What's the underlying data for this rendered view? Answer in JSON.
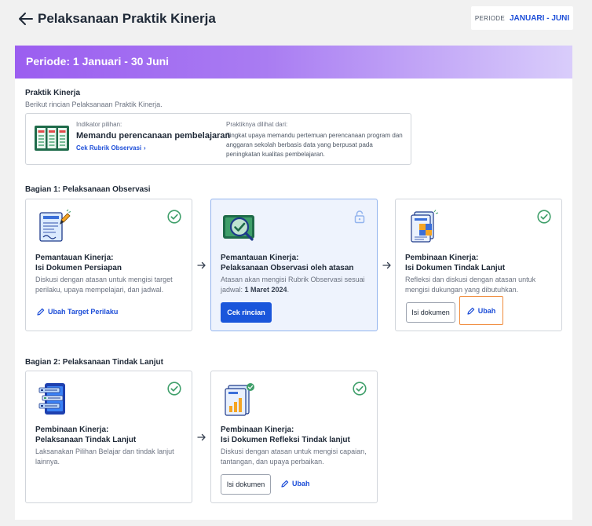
{
  "header": {
    "title": "Pelaksanaan Praktik Kinerja",
    "periode_label": "PERIODE",
    "periode_value": "JANUARI - JUNI"
  },
  "banner": {
    "text": "Periode: 1 Januari - 30 Juni"
  },
  "praktik": {
    "title": "Praktik Kinerja",
    "subtitle": "Berikut rincian Pelaksanaan Praktik Kinerja.",
    "indikator_label": "Indikator pilihan:",
    "indikator_value": "Memandu perencanaan pembelajaran",
    "rubrik_link": "Cek Rubrik Observasi",
    "rubrik_chevron": "›",
    "praktik_label": "Praktiknya dilihat dari:",
    "praktik_value": "Tingkat upaya memandu pertemuan perencanaan program dan anggaran sekolah berbasis data yang berpusat pada peningkatan kualitas pembelajaran."
  },
  "bagian1": {
    "title": "Bagian 1: Pelaksanaan Observasi",
    "cards": [
      {
        "title1": "Pemantauan Kinerja:",
        "title2": "Isi Dokumen Persiapan",
        "desc": "Diskusi dengan atasan untuk mengisi target perilaku, upaya mempelajari, dan jadwal.",
        "link": "Ubah Target Perilaku",
        "status": "check-icon"
      },
      {
        "title1": "Pemantauan Kinerja:",
        "title2": "Pelaksanaan Observasi oleh atasan",
        "desc_prefix": "Atasan akan mengisi Rubrik Observasi sesuai jadwal: ",
        "desc_bold": "1 Maret 2024",
        "desc_suffix": ".",
        "button": "Cek rincian",
        "status": "lock-icon"
      },
      {
        "title1": "Pembinaan Kinerja:",
        "title2": "Isi Dokumen Tindak Lanjut",
        "desc": "Refleksi dan diskusi dengan atasan untuk mengisi dukungan yang dibutuhkan.",
        "button": "Isi dokumen",
        "link": "Ubah",
        "status": "check-icon"
      }
    ]
  },
  "bagian2": {
    "title": "Bagian 2: Pelaksanaan Tindak Lanjut",
    "cards": [
      {
        "title1": "Pembinaan Kinerja:",
        "title2": "Pelaksanaan Tindak Lanjut",
        "desc": "Laksanakan Pilihan Belajar dan tindak lanjut lainnya.",
        "status": "check-icon"
      },
      {
        "title1": "Pembinaan Kinerja:",
        "title2": "Isi Dokumen Refleksi Tindak lanjut",
        "desc": "Diskusi dengan atasan untuk mengisi capaian, tantangan, dan upaya perbaikan.",
        "button": "Isi dokumen",
        "link": "Ubah",
        "status": "check-icon"
      }
    ]
  },
  "colors": {
    "accent": "#1a56db",
    "success": "#3f9f6a",
    "banner_start": "#9b5ef0",
    "highlight": "#f08a3a"
  }
}
